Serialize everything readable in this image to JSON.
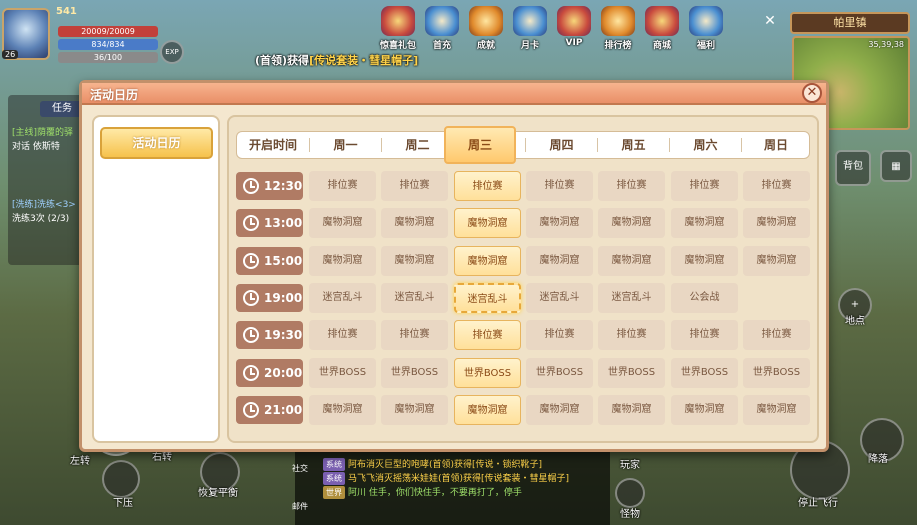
{
  "hud": {
    "level": "26",
    "player_name": "541",
    "hp": "20009/20009",
    "mp": "834/834",
    "xp": "36/100",
    "exp_tag": "EXP"
  },
  "top_icons": [
    "惊喜礼包",
    "首充",
    "成就",
    "月卡",
    "VIP",
    "排行榜",
    "商城",
    "福利"
  ],
  "map": {
    "title": "帕里镇",
    "coords": "35,39,38"
  },
  "notice": {
    "prefix": "(首领)",
    "text": "获得",
    "item": "[传说套装・彗星帽子]"
  },
  "left_panel": {
    "tab": "任务",
    "line1": "[主线]荫覆的驿",
    "line2": "对话 依斯特",
    "line3": "[洗练]洗练<3>",
    "line4": "洗练3次 (2/3)"
  },
  "right_buttons": {
    "bag": "背包",
    "more": "日历"
  },
  "actions": {
    "press_down": "下压",
    "restore_balance": "恢复平衡",
    "left_turn": "左转",
    "right_turn": "右转",
    "stop_flight": "停止飞行",
    "land": "降落",
    "player": "玩家",
    "monster": "怪物",
    "social": "社交",
    "mail": "邮件",
    "map_btn": "地点"
  },
  "chat": [
    {
      "tag": "系统",
      "text": "阿布消灭巨型的咆哮(首领)获得[传说・锁织靴子]"
    },
    {
      "tag": "系统",
      "text": "马飞飞消灭摇荡米娃娃(首领)获得[传说套装・彗星帽子]"
    },
    {
      "tag": "世界",
      "text": "阿川 住手，你们快住手，不要再打了，停手"
    }
  ],
  "modal": {
    "title": "活动日历",
    "close": "✕",
    "sidebar_tab": "活动日历",
    "header_time": "开启时间",
    "days": [
      "周一",
      "周二",
      "周三",
      "周四",
      "周五",
      "周六",
      "周日"
    ],
    "today_index": 2,
    "rows": [
      {
        "time": "12:30",
        "events": [
          "排位赛",
          "排位赛",
          "排位赛",
          "排位赛",
          "排位赛",
          "排位赛",
          "排位赛"
        ]
      },
      {
        "time": "13:00",
        "events": [
          "魔物洞窟",
          "魔物洞窟",
          "魔物洞窟",
          "魔物洞窟",
          "魔物洞窟",
          "魔物洞窟",
          "魔物洞窟"
        ]
      },
      {
        "time": "15:00",
        "events": [
          "魔物洞窟",
          "魔物洞窟",
          "魔物洞窟",
          "魔物洞窟",
          "魔物洞窟",
          "魔物洞窟",
          "魔物洞窟"
        ]
      },
      {
        "time": "19:00",
        "events": [
          "迷宫乱斗",
          "迷宫乱斗",
          "迷宫乱斗",
          "迷宫乱斗",
          "迷宫乱斗",
          "公会战",
          ""
        ]
      },
      {
        "time": "19:30",
        "events": [
          "排位赛",
          "排位赛",
          "排位赛",
          "排位赛",
          "排位赛",
          "排位赛",
          "排位赛"
        ]
      },
      {
        "time": "20:00",
        "events": [
          "世界BOSS",
          "世界BOSS",
          "世界BOSS",
          "世界BOSS",
          "世界BOSS",
          "世界BOSS",
          "世界BOSS"
        ]
      },
      {
        "time": "21:00",
        "events": [
          "魔物洞窟",
          "魔物洞窟",
          "魔物洞窟",
          "魔物洞窟",
          "魔物洞窟",
          "魔物洞窟",
          "魔物洞窟"
        ]
      }
    ],
    "selected_row": 3
  }
}
